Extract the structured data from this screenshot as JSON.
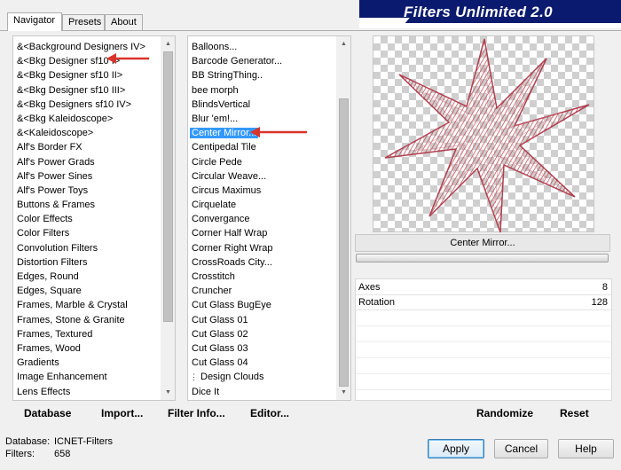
{
  "tabs": [
    "Navigator",
    "Presets",
    "About"
  ],
  "banner_title": "Filters Unlimited 2.0",
  "categories": [
    "&<Background Designers IV>",
    "&<Bkg Designer sf10 I>",
    "&<Bkg Designer sf10 II>",
    "&<Bkg Designer sf10 III>",
    "&<Bkg Designers sf10 IV>",
    "&<Bkg Kaleidoscope>",
    "&<Kaleidoscope>",
    "Alf's Border FX",
    "Alf's Power Grads",
    "Alf's Power Sines",
    "Alf's Power Toys",
    "Buttons & Frames",
    "Color Effects",
    "Color Filters",
    "Convolution Filters",
    "Distortion Filters",
    "Edges, Round",
    "Edges, Square",
    "Frames, Marble & Crystal",
    "Frames, Stone & Granite",
    "Frames, Textured",
    "Frames, Wood",
    "Gradients",
    "Image Enhancement",
    "Lens Effects"
  ],
  "filters": [
    {
      "label": "Balloons...",
      "sub": false
    },
    {
      "label": "Barcode Generator...",
      "sub": false
    },
    {
      "label": "BB StringThing..",
      "sub": false
    },
    {
      "label": "bee morph",
      "sub": false
    },
    {
      "label": "BlindsVertical",
      "sub": false
    },
    {
      "label": "Blur 'em!...",
      "sub": false
    },
    {
      "label": "Center Mirror...",
      "sub": false,
      "selected": true
    },
    {
      "label": "Centipedal Tile",
      "sub": false
    },
    {
      "label": "Circle Pede",
      "sub": false
    },
    {
      "label": "Circular Weave...",
      "sub": false
    },
    {
      "label": "Circus Maximus",
      "sub": false
    },
    {
      "label": "Cirquelate",
      "sub": false
    },
    {
      "label": "Convergance",
      "sub": false
    },
    {
      "label": "Corner Half Wrap",
      "sub": false
    },
    {
      "label": "Corner Right Wrap",
      "sub": false
    },
    {
      "label": "CrossRoads City...",
      "sub": false
    },
    {
      "label": "Crosstitch",
      "sub": false
    },
    {
      "label": "Cruncher",
      "sub": false
    },
    {
      "label": "Cut Glass  BugEye",
      "sub": false
    },
    {
      "label": "Cut Glass 01",
      "sub": false
    },
    {
      "label": "Cut Glass 02",
      "sub": false
    },
    {
      "label": "Cut Glass 03",
      "sub": false
    },
    {
      "label": "Cut Glass 04",
      "sub": false
    },
    {
      "label": "Design Clouds",
      "sub": true
    },
    {
      "label": "Dice It",
      "sub": false
    }
  ],
  "preview": {
    "filter_name": "Center Mirror..."
  },
  "params": [
    {
      "name": "Axes",
      "value": "8"
    },
    {
      "name": "Rotation",
      "value": "128"
    }
  ],
  "toolbar": {
    "database": "Database",
    "import": "Import...",
    "filter_info": "Filter Info...",
    "editor": "Editor...",
    "randomize": "Randomize",
    "reset": "Reset"
  },
  "status": {
    "database_label": "Database:",
    "database_value": "ICNET-Filters",
    "filters_label": "Filters:",
    "filters_value": "658"
  },
  "buttons": {
    "apply": "Apply",
    "cancel": "Cancel",
    "help": "Help"
  },
  "colors": {
    "selection": "#3399ff",
    "banner": "#0a1a6e",
    "arrow": "#d9342b",
    "star": "#c0404a"
  }
}
